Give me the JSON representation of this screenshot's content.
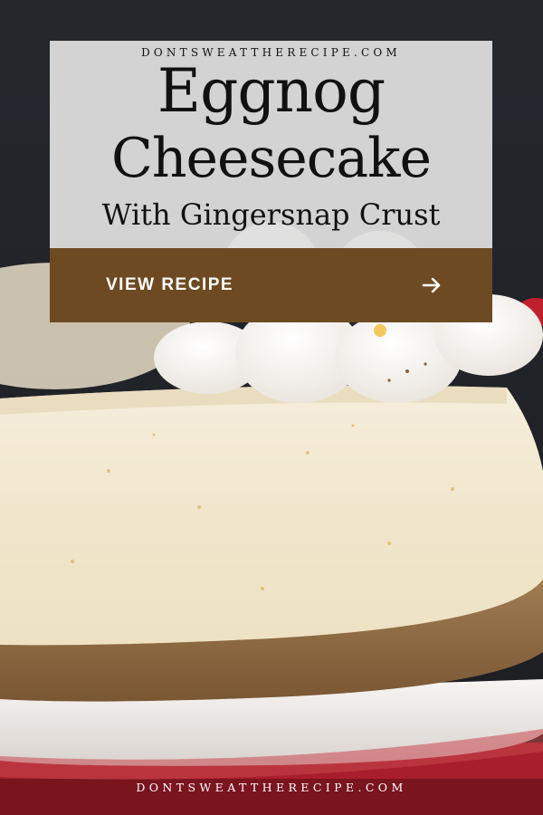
{
  "header": {
    "site_top": "DONTSWEATTHERECIPE.COM",
    "title_line1": "Eggnog",
    "title_line2": "Cheesecake",
    "subtitle": "With Gingersnap Crust"
  },
  "cta": {
    "label": "VIEW RECIPE",
    "icon": "arrow-right-icon"
  },
  "footer": {
    "site_bottom": "DONTSWEATTHERECIPE.COM"
  },
  "colors": {
    "card": "#dedede",
    "cta_bg": "#6e4a23",
    "cheesecake": "#f1e8cf",
    "crust": "#8d6a44",
    "plate": "#f3f0ee",
    "background_red": "#b3202f"
  }
}
